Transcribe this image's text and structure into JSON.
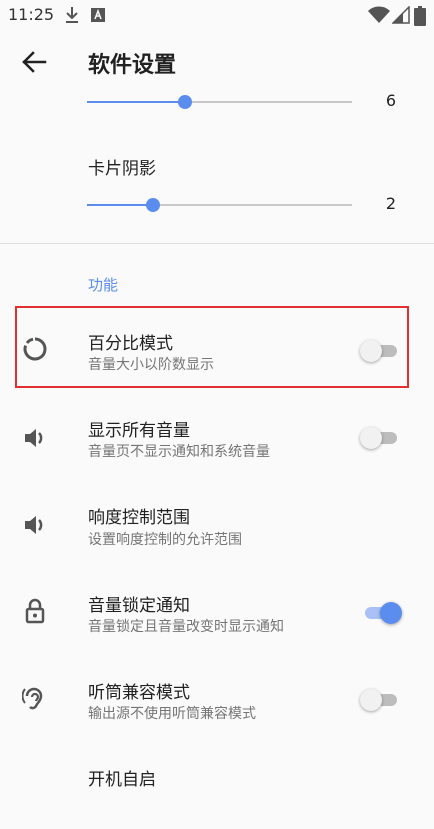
{
  "status_bar": {
    "time": "11:25"
  },
  "header": {
    "title": "软件设置"
  },
  "slider_top": {
    "value": "6",
    "fraction": 0.37
  },
  "card_shadow": {
    "label": "卡片阴影",
    "value": "2",
    "fraction": 0.25
  },
  "section_title": "功能",
  "items": [
    {
      "title": "百分比模式",
      "subtitle": "音量大小以阶数显示",
      "icon": "percent-circle-icon",
      "toggle": false
    },
    {
      "title": "显示所有音量",
      "subtitle": "音量页不显示通知和系统音量",
      "icon": "speaker-icon",
      "toggle": false
    },
    {
      "title": "响度控制范围",
      "subtitle": "设置响度控制的允许范围",
      "icon": "speaker-icon"
    },
    {
      "title": "音量锁定通知",
      "subtitle": "音量锁定且音量改变时显示通知",
      "icon": "lock-icon",
      "toggle": true
    },
    {
      "title": "听筒兼容模式",
      "subtitle": "输出源不使用听筒兼容模式",
      "icon": "ear-icon",
      "toggle": false
    },
    {
      "title": "开机自启",
      "subtitle": "",
      "icon": "power-icon"
    }
  ],
  "colors": {
    "accent": "#5b8def",
    "highlight": "#e03030"
  }
}
